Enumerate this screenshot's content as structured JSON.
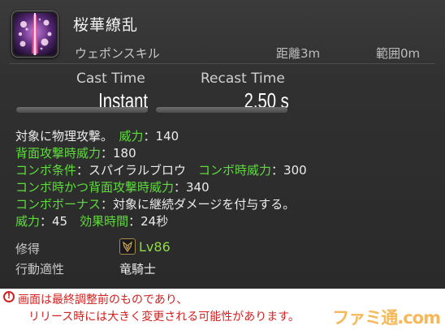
{
  "skill": {
    "name": "桜華繚乱",
    "type": "ウェポンスキル",
    "distance": "距離3m",
    "range": "範囲0m"
  },
  "cast": {
    "cast_label": "Cast Time",
    "cast_value": "Instant",
    "recast_label": "Recast Time",
    "recast_value": "2.50 s"
  },
  "description": [
    [
      {
        "t": "対象に物理攻撃。　",
        "g": false
      },
      {
        "t": "威力",
        "g": true
      },
      {
        "t": "：140",
        "g": false
      }
    ],
    [
      {
        "t": "背面攻撃時威力",
        "g": true
      },
      {
        "t": "：180",
        "g": false
      }
    ],
    [
      {
        "t": "コンボ条件",
        "g": true
      },
      {
        "t": "：スパイラルブロウ　",
        "g": false
      },
      {
        "t": "コンボ時威力",
        "g": true
      },
      {
        "t": "：300",
        "g": false
      }
    ],
    [
      {
        "t": "コンボ時かつ背面攻撃時威力",
        "g": true
      },
      {
        "t": "：340",
        "g": false
      }
    ],
    [
      {
        "t": "コンボボーナス",
        "g": true
      },
      {
        "t": "：対象に継続ダメージを付与する。",
        "g": false
      }
    ],
    [
      {
        "t": "威力",
        "g": true
      },
      {
        "t": "：45　",
        "g": false
      },
      {
        "t": "効果時間",
        "g": true
      },
      {
        "t": "：24秒",
        "g": false
      }
    ]
  ],
  "acquired": {
    "label": "修得",
    "level": "Lv86",
    "job_icon": "dragoon-job-icon"
  },
  "affinity": {
    "label": "行動適性",
    "value": "竜騎士"
  },
  "notice": {
    "icon": "warning-icon",
    "line1": "画面は最終調整前のものであり、",
    "line2": "リリース時には大きく変更される可能性があります。"
  },
  "watermark": "ファミ通.com",
  "colors": {
    "highlight": "#5fdc3d",
    "level": "#8ade3f",
    "notice": "#d32020",
    "watermark": "#f6b24d"
  }
}
